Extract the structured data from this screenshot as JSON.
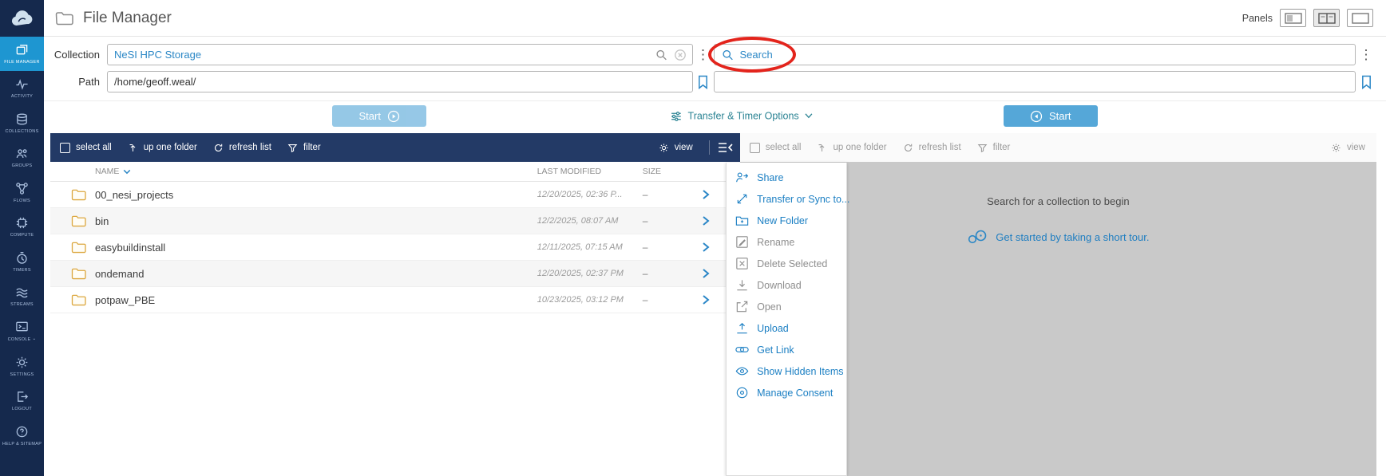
{
  "colors": {
    "navy": "#15294d",
    "toolbar_navy": "#233a66",
    "accent_blue": "#1f7ec1",
    "active_sidebar_blue": "#1e96d1",
    "button_blue": "#55a7d8",
    "teal": "#2a8393",
    "folder_yellow": "#dca73f",
    "panel_gray": "#c9c9c9",
    "annotation_red": "#e3241c"
  },
  "header": {
    "title": "File Manager",
    "panels_label": "Panels",
    "logo_icon": "globus-cloud-logo",
    "title_icon": "folder-icon",
    "panel_buttons": [
      "single-panel",
      "two-panel",
      "wide-panel"
    ]
  },
  "sidebar": {
    "items": [
      {
        "label": "FILE MANAGER",
        "icon": "file-manager-icon",
        "active": true
      },
      {
        "label": "ACTIVITY",
        "icon": "activity-icon",
        "active": false
      },
      {
        "label": "COLLECTIONS",
        "icon": "collections-icon",
        "active": false
      },
      {
        "label": "GROUPS",
        "icon": "groups-icon",
        "active": false
      },
      {
        "label": "FLOWS",
        "icon": "flows-icon",
        "active": false
      },
      {
        "label": "COMPUTE",
        "icon": "compute-icon",
        "active": false
      },
      {
        "label": "TIMERS",
        "icon": "timers-icon",
        "active": false
      },
      {
        "label": "STREAMS",
        "icon": "streams-icon",
        "active": false
      },
      {
        "label": "CONSOLE",
        "icon": "console-icon",
        "active": false
      },
      {
        "label": "SETTINGS",
        "icon": "settings-icon",
        "active": false
      },
      {
        "label": "LOGOUT",
        "icon": "logout-icon",
        "active": false
      },
      {
        "label": "HELP & SITEMAP",
        "icon": "help-icon",
        "active": false
      }
    ]
  },
  "collection_bar": {
    "collection_label": "Collection",
    "collection_value": "NeSI HPC Storage",
    "path_label": "Path",
    "path_value": "/home/geoff.weal/",
    "search_placeholder": "Search"
  },
  "transfer_bar": {
    "start_left": "Start",
    "options": "Transfer & Timer Options",
    "start_right": "Start"
  },
  "toolbar": {
    "select_all": "select all",
    "up_one_folder": "up one folder",
    "refresh_list": "refresh list",
    "filter": "filter",
    "view": "view"
  },
  "table": {
    "headers": {
      "name": "NAME",
      "modified": "LAST MODIFIED",
      "size": "SIZE"
    },
    "rows": [
      {
        "name": "00_nesi_projects",
        "modified": "12/20/2025, 02:36 P...",
        "size": "–"
      },
      {
        "name": "bin",
        "modified": "12/2/2025, 08:07 AM",
        "size": "–"
      },
      {
        "name": "easybuildinstall",
        "modified": "12/11/2025, 07:15 AM",
        "size": "–"
      },
      {
        "name": "ondemand",
        "modified": "12/20/2025, 02:37 PM",
        "size": "–"
      },
      {
        "name": "potpaw_PBE",
        "modified": "10/23/2025, 03:12 PM",
        "size": "–"
      }
    ]
  },
  "action_menu": {
    "items": [
      {
        "label": "Share",
        "icon": "share-icon",
        "enabled": true
      },
      {
        "label": "Transfer or Sync to...",
        "icon": "transfer-icon",
        "enabled": true
      },
      {
        "label": "New Folder",
        "icon": "new-folder-icon",
        "enabled": true
      },
      {
        "label": "Rename",
        "icon": "rename-icon",
        "enabled": false
      },
      {
        "label": "Delete Selected",
        "icon": "delete-icon",
        "enabled": false
      },
      {
        "label": "Download",
        "icon": "download-icon",
        "enabled": false
      },
      {
        "label": "Open",
        "icon": "open-icon",
        "enabled": false
      },
      {
        "label": "Upload",
        "icon": "upload-icon",
        "enabled": true
      },
      {
        "label": "Get Link",
        "icon": "link-icon",
        "enabled": true
      },
      {
        "label": "Show Hidden Items",
        "icon": "eye-icon",
        "enabled": true
      },
      {
        "label": "Manage Consent",
        "icon": "consent-icon",
        "enabled": true
      }
    ]
  },
  "right_panel": {
    "message": "Search for a collection to begin",
    "tour_text": "Get started by taking a short tour."
  }
}
